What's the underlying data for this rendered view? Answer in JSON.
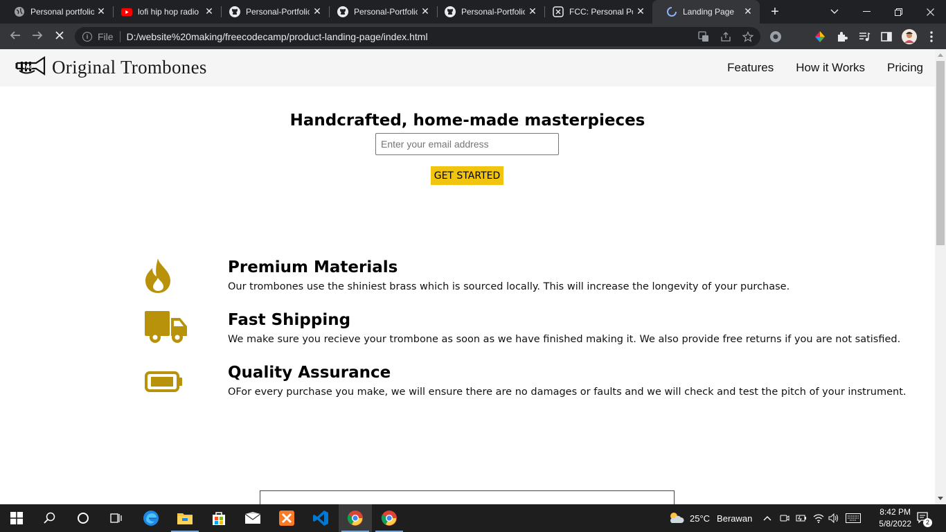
{
  "browser": {
    "tabs": [
      {
        "title": "Personal portfolio",
        "icon": "globe-icon"
      },
      {
        "title": "lofi hip hop radio",
        "icon": "youtube-icon"
      },
      {
        "title": "Personal-Portfolio",
        "icon": "github-icon"
      },
      {
        "title": "Personal-Portfolio",
        "icon": "github-icon"
      },
      {
        "title": "Personal-Portfolio",
        "icon": "github-icon"
      },
      {
        "title": "FCC: Personal Portfolio",
        "icon": "freecodecamp-icon"
      },
      {
        "title": "Landing Page",
        "icon": "loading-icon",
        "active": true
      }
    ],
    "address": {
      "scheme": "File",
      "url": "D:/website%20making/freecodecamp/product-landing-page/index.html"
    }
  },
  "site": {
    "logo_text": "Original Trombones",
    "nav": [
      "Features",
      "How it Works",
      "Pricing"
    ],
    "hero": {
      "title": "Handcrafted, home-made masterpieces",
      "email_placeholder": "Enter your email address",
      "cta_label": "GET STARTED"
    },
    "features": [
      {
        "icon": "fire-icon",
        "title": "Premium Materials",
        "text": "Our trombones use the shiniest brass which is sourced locally. This will increase the longevity of your purchase."
      },
      {
        "icon": "truck-icon",
        "title": "Fast Shipping",
        "text": "We make sure you recieve your trombone as soon as we have finished making it. We also provide free returns if you are not satisfied."
      },
      {
        "icon": "battery-icon",
        "title": "Quality Assurance",
        "text": "OFor every purchase you make, we will ensure there are no damages or faults and we will check and test the pitch of your instrument."
      }
    ],
    "accent_color": "#f1c40f",
    "icon_color": "#b8920a"
  },
  "taskbar": {
    "weather": {
      "temp": "25°C",
      "condition": "Berawan"
    },
    "time": "8:42 PM",
    "date": "5/8/2022",
    "notifications": "2"
  }
}
